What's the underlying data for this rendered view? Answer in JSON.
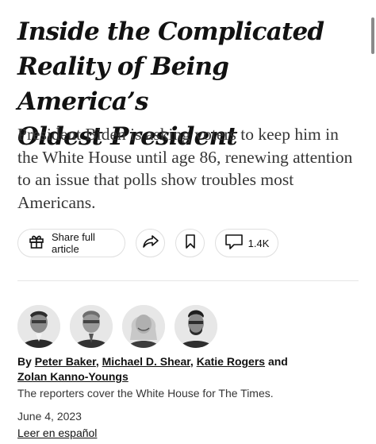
{
  "headline": {
    "line1": "Inside the Complicated",
    "line2": "Reality of Being America’s",
    "line3": "Oldest President"
  },
  "summary": "President Biden is asking voters to keep him in the White House until age 86, renewing attention to an issue that polls show troubles most Americans.",
  "actions": {
    "share_full_article_label": "Share full article",
    "share_icon": "share-arrow-icon",
    "save_icon": "bookmark-icon",
    "comments_icon": "comment-bubble-icon",
    "comments_count": "1.4K"
  },
  "byline": {
    "prefix": "By",
    "authors": [
      "Peter Baker",
      "Michael D. Shear",
      "Katie Rogers",
      "Zolan Kanno-Youngs"
    ],
    "separator": ",",
    "conjunction": "and",
    "note": "The reporters cover the White House for The Times."
  },
  "date": "June 4, 2023",
  "language_link": "Leer en español",
  "colors": {
    "text": "#121212",
    "secondary_text": "#363636",
    "border": "#dfdfdf"
  }
}
